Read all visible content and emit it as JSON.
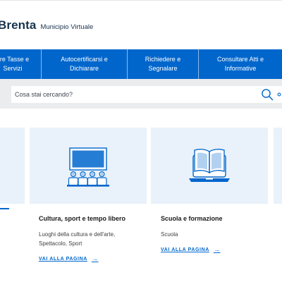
{
  "brand": {
    "name": "Brenta",
    "subtitle": "Municipio Virtuale"
  },
  "nav": {
    "items": [
      {
        "label": "are Tasse e\nServizi"
      },
      {
        "label": "Autocertificarsi e\nDichiarare"
      },
      {
        "label": "Richiedere e\nSegnalare"
      },
      {
        "label": "Consultare Atti e\nInformative"
      }
    ]
  },
  "search": {
    "placeholder": "Cosa stai cercando?"
  },
  "cards": [
    {
      "title": "Cultura, sport e tempo libero",
      "description": "Luoghi della cultura e dell'arte,\nSpettacolo, Sport",
      "link": "VAI ALLA PAGINA",
      "icon": "theater-icon"
    },
    {
      "title": "Scuola e formazione",
      "description": "Scuola",
      "link": "VAI ALLA PAGINA",
      "icon": "laptop-book-icon"
    }
  ],
  "colors": {
    "primary": "#0066cc",
    "card_bg": "#e9f1fa",
    "search_band": "#ebeced",
    "brand_text": "#17324d"
  }
}
